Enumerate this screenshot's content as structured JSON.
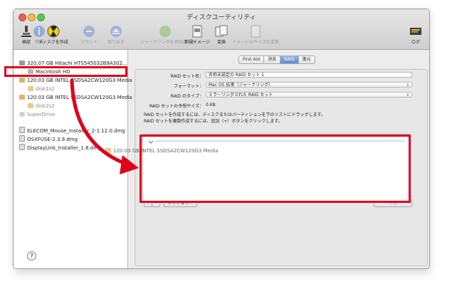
{
  "window": {
    "title": "ディスクユーティリティ"
  },
  "toolbar": {
    "items": [
      {
        "label": "検証",
        "icon": "microscope-icon",
        "enabled": true
      },
      {
        "label": "情報",
        "icon": "info-icon",
        "enabled": false
      },
      {
        "label": "ディスクを作成",
        "icon": "burn-icon",
        "enabled": true
      },
      {
        "label": "マウント",
        "icon": "mount-icon",
        "enabled": false
      },
      {
        "label": "取り出す",
        "icon": "eject-icon",
        "enabled": false
      },
      {
        "label": "ジャーナリングを有効にする",
        "icon": "journaling-icon",
        "enabled": false
      },
      {
        "label": "新規イメージ",
        "icon": "new-image-icon",
        "enabled": true
      },
      {
        "label": "変換",
        "icon": "convert-icon",
        "enabled": true
      },
      {
        "label": "イメージのサイズを変更",
        "icon": "resize-image-icon",
        "enabled": false
      },
      {
        "label": "ログ",
        "icon": "log-icon",
        "enabled": true
      }
    ]
  },
  "sidebar": {
    "items": [
      {
        "label": "320.07 GB Hitachi HTS545032B9A302...",
        "type": "disk",
        "indent": 0,
        "muted": false
      },
      {
        "label": "Macintosh HD",
        "type": "volume",
        "indent": 1,
        "muted": false
      },
      {
        "label": "120.03 GB INTEL SSDSA2CW120G3 Media",
        "type": "disk",
        "indent": 0,
        "muted": false,
        "selected": true
      },
      {
        "label": "disk1s2",
        "type": "volume",
        "indent": 1,
        "muted": true
      },
      {
        "label": "120.03 GB INTEL SSDSA2CW120G3 Media",
        "type": "disk",
        "indent": 0,
        "muted": false
      },
      {
        "label": "disk2s2",
        "type": "volume",
        "indent": 1,
        "muted": true
      },
      {
        "label": "SuperDrive",
        "type": "optical",
        "indent": 0,
        "muted": true
      },
      {
        "label": "ELECOM_Mouse_Installer_2-1.12.0.dmg",
        "type": "image",
        "indent": 0,
        "muted": false
      },
      {
        "label": "OSXFUSE-2.3.9.dmg",
        "type": "image",
        "indent": 0,
        "muted": false
      },
      {
        "label": "DisplayLink_Installer_1.8.dmg",
        "type": "image",
        "indent": 0,
        "muted": false
      }
    ],
    "help_label": "?"
  },
  "tabs": [
    {
      "label": "First Aid",
      "active": false
    },
    {
      "label": "消去",
      "active": false
    },
    {
      "label": "RAID",
      "active": true
    },
    {
      "label": "復元",
      "active": false
    }
  ],
  "raid": {
    "name_label": "RAID セット名：",
    "name_value": "名称未設定の RAID セット 1",
    "format_label": "フォーマット：",
    "format_value": "Mac OS 拡張（ジャーナリング）",
    "type_label": "RAID のタイプ：",
    "type_value": "ミラーリングされた RAID セット",
    "size_label": "RAID セットの予想サイズ：",
    "size_value": "0 KB",
    "info_line1": "RAID セットを作成するには、ディスクまたはパーティションを下のリストにドラッグします。",
    "info_line2": "RAID セットを複数作成するには、追加（+）ボタンをクリックします。",
    "drag_item": "120.03 GB INTEL SSDSA2CW120G3 Media",
    "add_label": "+",
    "remove_label": "−",
    "options_label": "オプション…",
    "create_label": "作成"
  },
  "colors": {
    "highlight": "#e0001b",
    "active_tab": "#5b8dd4"
  }
}
